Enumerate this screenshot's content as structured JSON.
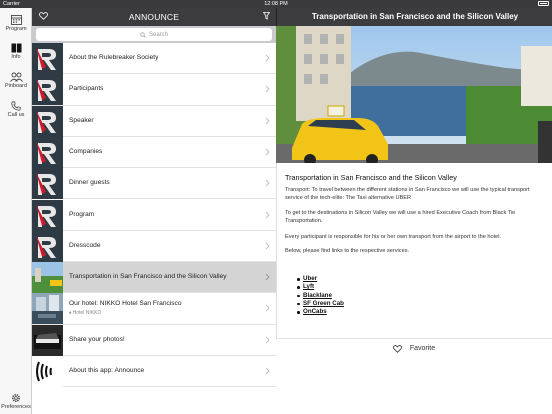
{
  "status": {
    "carrier": "Carrier",
    "time": "12:08 PM"
  },
  "tabs": [
    {
      "label": "Program",
      "icon": "calendar-icon"
    },
    {
      "label": "Info",
      "icon": "book-icon"
    },
    {
      "label": "Pinboard",
      "icon": "people-icon"
    },
    {
      "label": "Call us",
      "icon": "phone-icon"
    },
    {
      "label": "Preferences",
      "icon": "gear-icon"
    }
  ],
  "master": {
    "title": "ANNOUNCE",
    "search_placeholder": "Search",
    "items": [
      {
        "label": "About the Rulebreaker Society",
        "thumb": "r-logo"
      },
      {
        "label": "Participants",
        "thumb": "r-logo"
      },
      {
        "label": "Speaker",
        "thumb": "r-logo"
      },
      {
        "label": "Companies",
        "thumb": "r-logo"
      },
      {
        "label": "Dinner guests",
        "thumb": "r-logo"
      },
      {
        "label": "Program",
        "thumb": "r-logo"
      },
      {
        "label": "Dresscode",
        "thumb": "r-logo"
      },
      {
        "label": "Transportation in San Francisco and the Silicon Valley",
        "thumb": "sf-photo"
      },
      {
        "label": "Our hotel: NIKKO Hotel San Francisco",
        "sub": "Hotel NIKKO",
        "thumb": "hotel-photo"
      },
      {
        "label": "Share your photos!",
        "thumb": "piano-photo"
      },
      {
        "label": "About this app: Announce",
        "thumb": "waves-logo"
      }
    ]
  },
  "detail": {
    "header_title": "Transportation in San Francisco and the Silicon Valley",
    "heading": "Transportation in San Francisco and the Silicon Valley",
    "p1": "Transport: To travel between the different stations in San Francisco we will use the typical transport service of the tech-elite: The Taxi alternative UBER",
    "p2": "To get to the destinations in Silicon Valley we will use a hired Executive Coach from Black Tie Transportation.",
    "p3": "Every participant is responsible for his or her own transport from the airport to the hotel.",
    "p4": "Below, please find links to the respective services.",
    "links": [
      "Uber",
      "Lyft",
      "Blacklane",
      "SF Green Cab",
      "OnCabs"
    ],
    "favorite_label": "Favorite"
  },
  "colors": {
    "header": "#3c3c3e",
    "selected_row": "#d4d4d4",
    "accent_red": "#d01a2b"
  }
}
